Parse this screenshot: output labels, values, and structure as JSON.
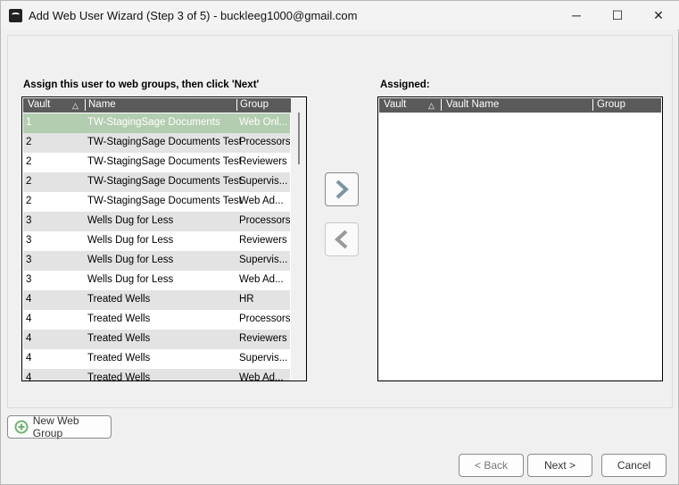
{
  "window": {
    "title": "Add Web User Wizard (Step 3 of 5) - buckleeg1000@gmail.com",
    "minimize": "─",
    "maximize": "☐",
    "close": "✕"
  },
  "available": {
    "label": "Assign this user to web groups, then click 'Next'",
    "columns": [
      "Vault",
      "Name",
      "Group"
    ],
    "sort_indicator": "△",
    "rows": [
      [
        "1",
        "TW-StagingSage Documents",
        "Web Onl..."
      ],
      [
        "2",
        "TW-StagingSage Documents Test",
        "Processors"
      ],
      [
        "2",
        "TW-StagingSage Documents Test",
        "Reviewers"
      ],
      [
        "2",
        "TW-StagingSage Documents Test",
        "Supervis..."
      ],
      [
        "2",
        "TW-StagingSage Documents Test",
        "Web Ad..."
      ],
      [
        "3",
        "Wells Dug for Less",
        "Processors"
      ],
      [
        "3",
        "Wells Dug for Less",
        "Reviewers"
      ],
      [
        "3",
        "Wells Dug for Less",
        "Supervis..."
      ],
      [
        "3",
        "Wells Dug for Less",
        "Web Ad..."
      ],
      [
        "4",
        "Treated Wells",
        "HR"
      ],
      [
        "4",
        "Treated Wells",
        "Processors"
      ],
      [
        "4",
        "Treated Wells",
        "Reviewers"
      ],
      [
        "4",
        "Treated Wells",
        "Supervis..."
      ],
      [
        "4",
        "Treated Wells",
        "Web Ad..."
      ]
    ],
    "selected_index": 0
  },
  "assigned": {
    "label": "Assigned:",
    "columns": [
      "Vault",
      "Vault Name",
      "Group"
    ],
    "sort_indicator": "△"
  },
  "buttons": {
    "new_group": "New Web Group",
    "back": "< Back",
    "next": "Next >",
    "cancel": "Cancel"
  },
  "colors": {
    "selected_row": "#b3cdb0",
    "alt_row": "#e3e3e3",
    "header": "#5a5a5a"
  }
}
